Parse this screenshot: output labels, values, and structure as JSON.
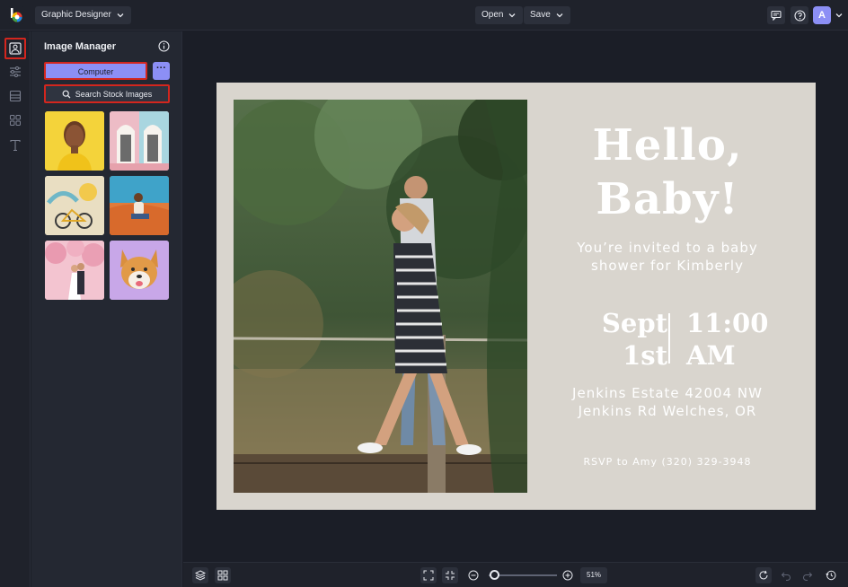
{
  "topbar": {
    "mode_label": "Graphic Designer",
    "open_label": "Open",
    "save_label": "Save",
    "avatar_initial": "A"
  },
  "sidebar_rail": {
    "items": [
      "image-manager",
      "adjustments",
      "layout",
      "graphics",
      "text"
    ],
    "active": "image-manager"
  },
  "image_manager": {
    "title": "Image Manager",
    "computer_label": "Computer",
    "more_label": "···",
    "search_stock_label": "Search Stock Images",
    "thumbnails": [
      "woman-yellow-background",
      "pink-doors",
      "bicycle-mural",
      "man-sitting-desert",
      "wedding-couple-pink-trees",
      "shiba-inu-dog"
    ]
  },
  "design": {
    "headline": "Hello, Baby!",
    "invite_text": "You’re invited to a baby shower for Kimberly",
    "date": "Sept 1st",
    "time": "11:00 AM",
    "address": "Jenkins Estate 42004 NW Jenkins Rd Welches, OR",
    "rsvp": "RSVP to Amy (320) 329-3948",
    "background_color": "#d9d5ce"
  },
  "bottombar": {
    "zoom": "51%"
  },
  "colors": {
    "accent": "#8c8ff5",
    "highlight": "#d3261e",
    "chrome": "#1f222b",
    "canvas_bg": "#1b1e27"
  }
}
